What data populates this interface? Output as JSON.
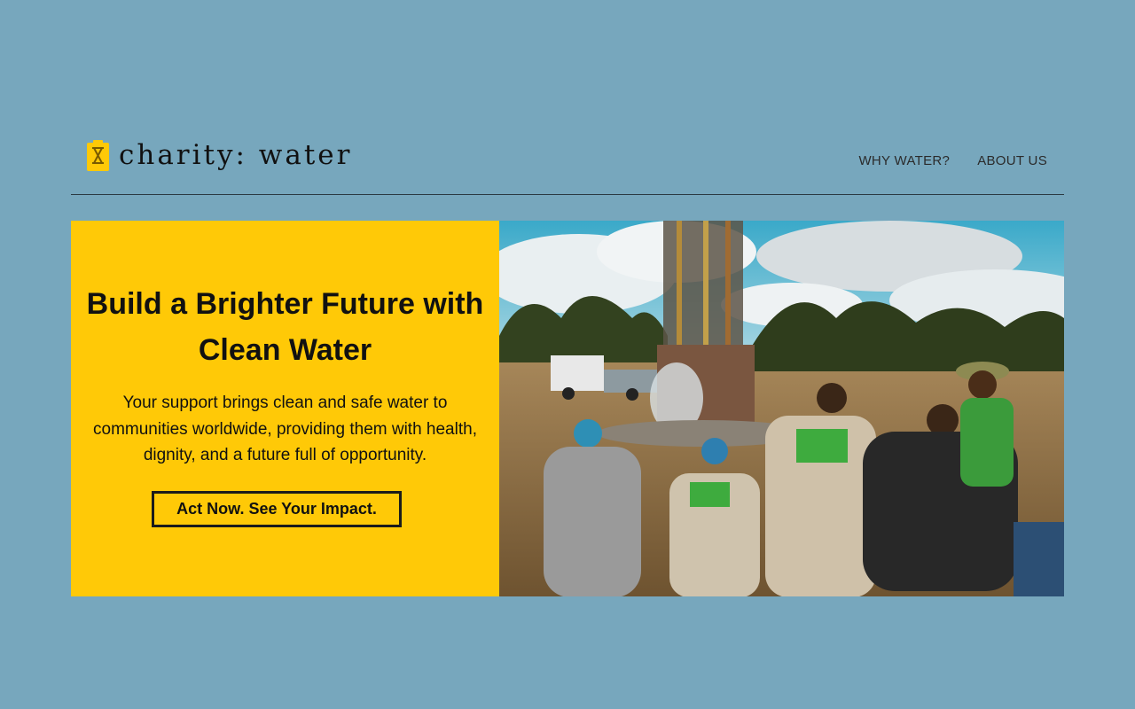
{
  "brand": {
    "name": "charity: water",
    "logo_icon": "jerrycan-icon",
    "accent_color": "#ffc907"
  },
  "nav": {
    "items": [
      {
        "label": "WHY WATER?"
      },
      {
        "label": "ABOUT US"
      }
    ]
  },
  "hero": {
    "headline": "Build a Brighter Future with Clean Water",
    "body": "Your support brings clean and safe water to communities worldwide, providing them with health, dignity, and a future full of opportunity.",
    "cta_label": "Act Now. See Your Impact.",
    "image": "Photo of a water well drilling rig in a grassy field, watched by a seated group of people wearing caps and vests."
  }
}
